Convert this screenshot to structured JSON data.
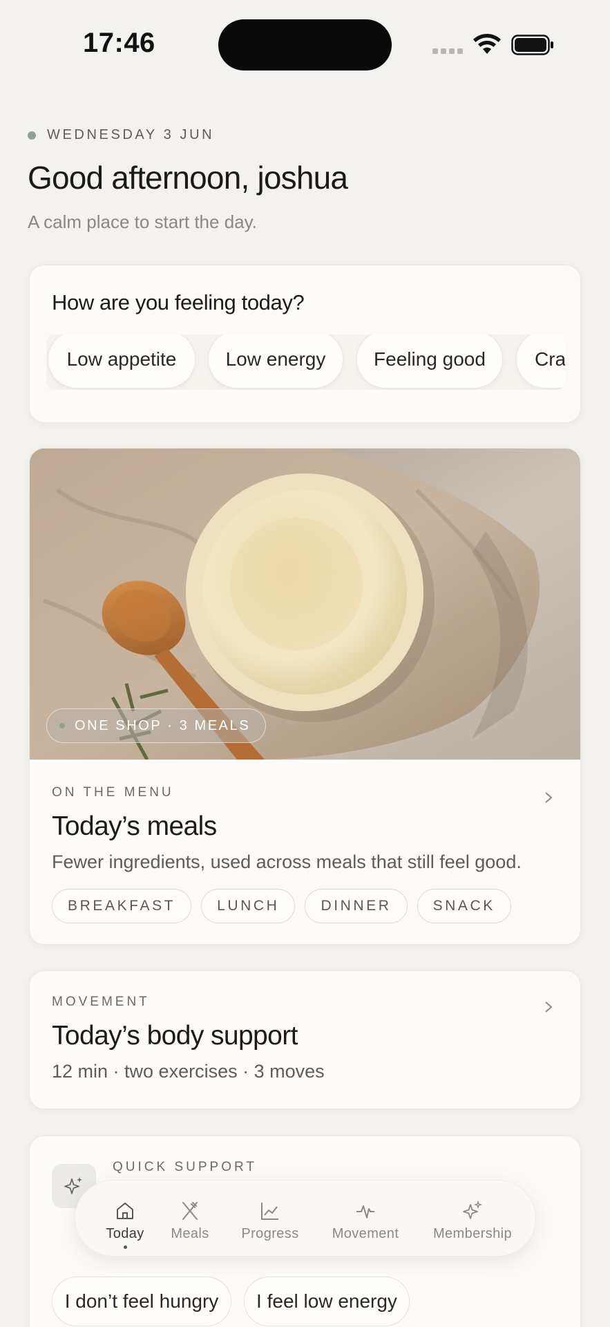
{
  "status_bar": {
    "time": "17:46"
  },
  "header": {
    "date": "WEDNESDAY 3 JUN",
    "greeting": "Good afternoon, joshua",
    "tagline": "A calm place to start the day."
  },
  "feeling": {
    "title": "How are you feeling today?",
    "options": [
      "Low appetite",
      "Low energy",
      "Feeling good",
      "Cra"
    ]
  },
  "meals": {
    "badge": "ONE SHOP · 3 MEALS",
    "eyebrow": "ON THE MENU",
    "title": "Today’s meals",
    "subtitle": "Fewer ingredients, used across meals that still feel good.",
    "tags": [
      "BREAKFAST",
      "LUNCH",
      "DINNER",
      "SNACK"
    ]
  },
  "movement": {
    "eyebrow": "MOVEMENT",
    "title": "Today’s body support",
    "subtitle": "12 min · two exercises · 3 moves"
  },
  "quick_support": {
    "eyebrow": "QUICK SUPPORT",
    "chips": [
      "I don’t feel hungry",
      "I feel low energy"
    ]
  },
  "tab_bar": {
    "active": "Today",
    "tabs": [
      {
        "label": "Today",
        "icon": "home-icon"
      },
      {
        "label": "Meals",
        "icon": "utensils-icon"
      },
      {
        "label": "Progress",
        "icon": "chart-icon"
      },
      {
        "label": "Movement",
        "icon": "pulse-icon"
      },
      {
        "label": "Membership",
        "icon": "sparkle-icon"
      }
    ]
  },
  "colors": {
    "background": "#f4f2ee",
    "card": "#fdfbf7",
    "accent": "#8fa395",
    "text": "#1c1b19",
    "muted": "#8a8884"
  }
}
